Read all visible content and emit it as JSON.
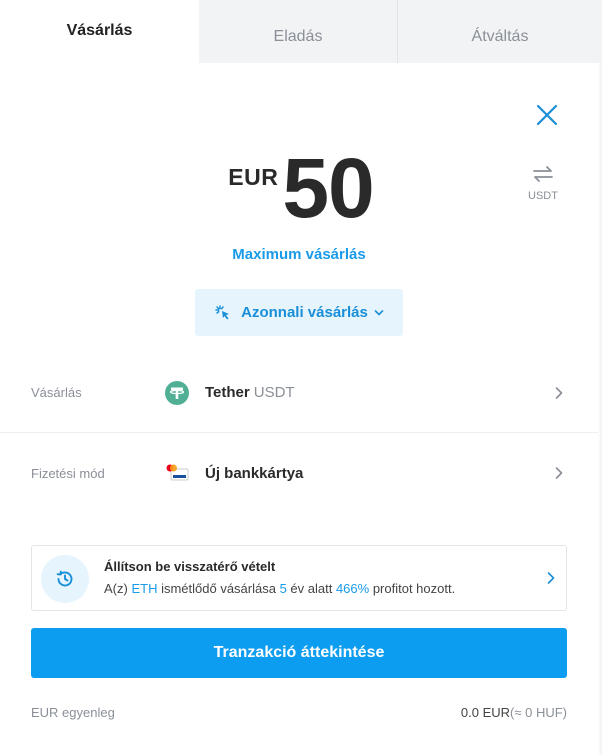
{
  "tabs": [
    {
      "label": "Vásárlás",
      "active": true
    },
    {
      "label": "Eladás",
      "active": false
    },
    {
      "label": "Átváltás",
      "active": false
    }
  ],
  "amount": {
    "currency": "EUR",
    "value": "50"
  },
  "swap": {
    "label": "USDT",
    "icon": "swap-arrows-icon"
  },
  "max_link": "Maximum vásárlás",
  "instant_button": {
    "label": "Azonnali vásárlás",
    "icon": "instant-click-icon"
  },
  "rows": [
    {
      "label": "Vásárlás",
      "title": "Tether",
      "subtitle": "USDT",
      "icon": "tether-icon"
    },
    {
      "label": "Fizetési mód",
      "title": "Új bankkártya",
      "subtitle": "",
      "icon": "bank-card-icon"
    }
  ],
  "recurring": {
    "title": "Állítson be visszatérő vételt",
    "text_prefix": "A(z) ",
    "coin": "ETH",
    "text_mid1": " ismétlődő vásárlása ",
    "years": "5",
    "text_mid2": " év alatt ",
    "percent": "466%",
    "text_suffix": " profitot hozott.",
    "icon": "history-icon"
  },
  "cta_label": "Tranzakció áttekintése",
  "balance": {
    "label": "EUR egyenleg",
    "value": "0.0 EUR",
    "converted": "(≈ 0 HUF)"
  },
  "colors": {
    "accent": "#0c9cf0",
    "link": "#1a9bea",
    "tether": "#50af95"
  }
}
